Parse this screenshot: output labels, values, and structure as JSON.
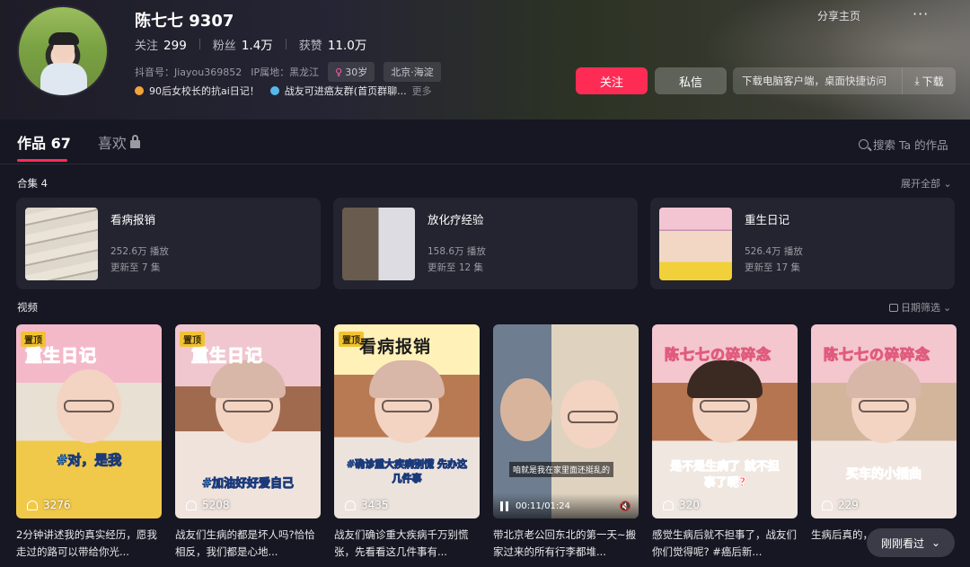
{
  "profile": {
    "name": "陈七七 9307",
    "follow_label": "关注",
    "follow_count": "299",
    "fans_label": "粉丝",
    "fans_count": "1.4万",
    "likes_label": "获赞",
    "likes_count": "11.0万",
    "douyin_id": "抖音号：Jiayou369852",
    "ip": "IP属地：黑龙江",
    "age": "30岁",
    "location": "北京·海淀",
    "bio1": "90后女校长的抗ai日记！",
    "bio2": "战友可进癌友群(首页群聊...",
    "bio_more": "更多"
  },
  "header": {
    "share": "分享主页",
    "more": "···",
    "follow_button": "关注",
    "message_button": "私信",
    "download_text": "下载电脑客户端，桌面快捷访问",
    "download_button": "下载"
  },
  "tabs": [
    {
      "label": "作品 67"
    },
    {
      "label": "喜欢"
    }
  ],
  "search_label": "搜索 Ta 的作品",
  "collections": {
    "title": "合集 4",
    "expand": "展开全部",
    "items": [
      {
        "title": "看病报销",
        "plays": "252.6万 播放",
        "updated": "更新至 7 集"
      },
      {
        "title": "放化疗经验",
        "plays": "158.6万 播放",
        "updated": "更新至 12 集"
      },
      {
        "title": "重生日记",
        "plays": "526.4万 播放",
        "updated": "更新至 17 集"
      }
    ]
  },
  "videos": {
    "label": "视频",
    "filter": "日期筛选",
    "items": [
      {
        "pin": "置顶",
        "banner": "重生日记",
        "sub": "#对，是我",
        "likes": "3276",
        "desc": "2分钟讲述我的真实经历，愿我走过的路可以带给你光..."
      },
      {
        "pin": "置顶",
        "banner": "重生日记",
        "sub": "#加油好好爱自己",
        "likes": "5208",
        "desc": "战友们生病的都是坏人吗?恰恰相反，我们都是心地..."
      },
      {
        "pin": "置顶",
        "banner": "看病报销",
        "sub": "#确诊重大疾病别慌 先办这几件事",
        "likes": "3435",
        "desc": "战友们确诊重大疾病千万别慌张，先看看这几件事有..."
      },
      {
        "caption": "咱就是我在家里面还挺乱的",
        "time": "00:11/01:24",
        "desc": "带北京老公回东北的第一天~搬家过来的所有行李都堆..."
      },
      {
        "banner": "陈七七の碎碎念",
        "sub": "是不是生病了 就不担事了呢?",
        "likes": "320",
        "desc": "感觉生病后就不担事了，战友们你们觉得呢? #癌后新..."
      },
      {
        "banner": "陈七七の碎碎念",
        "sub": "买车的小插曲",
        "likes": "229",
        "desc": "生病后真的，明明想好的..."
      }
    ]
  },
  "recent_button": "刚刚看过",
  "colors": {
    "accent": "#fe2c55",
    "background": "#161722"
  }
}
